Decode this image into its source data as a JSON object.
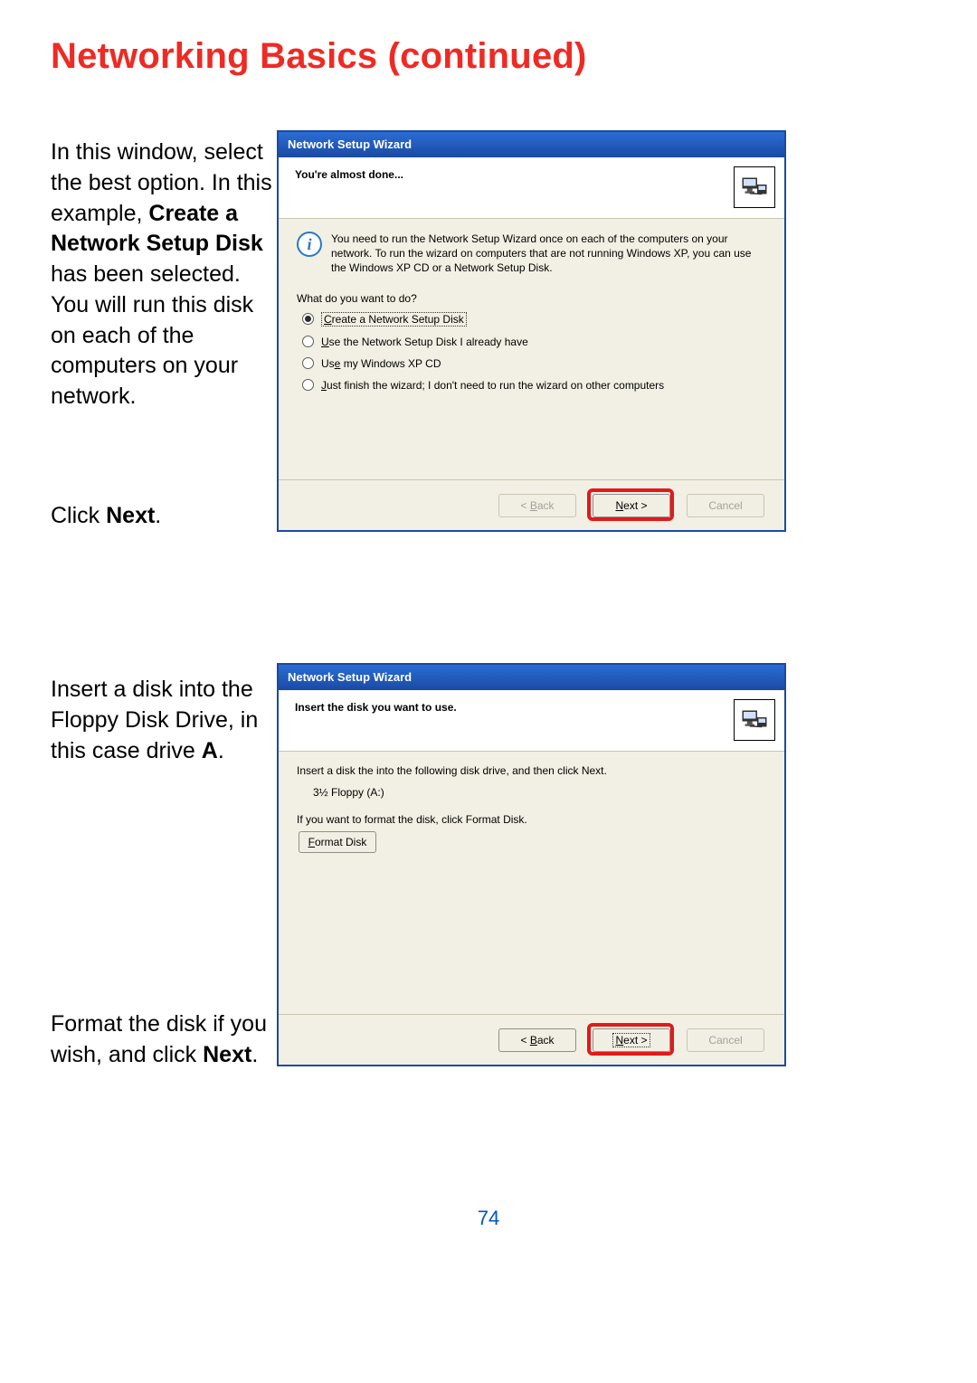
{
  "page": {
    "title": "Networking Basics (continued)",
    "number": "74"
  },
  "left": {
    "para1_pre": "In this window, select the best option. In this example, ",
    "para1_bold": "Create a Network Setup Disk",
    "para1_post": " has been selected. You will run this disk on each of the computers on your network.",
    "para2_pre": "Click ",
    "para2_bold": "Next",
    "para2_post": ".",
    "para3_pre": "Insert a disk into the Floppy Disk Drive, in this case drive ",
    "para3_bold": "A",
    "para3_post": ".",
    "para4_pre": "Format the disk if you wish, and click ",
    "para4_bold": "Next",
    "para4_post": "."
  },
  "wizard1": {
    "titlebar": "Network Setup Wizard",
    "header": "You're almost done...",
    "info": "You need to run the Network Setup Wizard once on each of the computers on your network. To run the wizard on computers that are not running Windows XP, you can use the Windows XP CD or a Network Setup Disk.",
    "prompt": "What do you want to do?",
    "options": {
      "o1_u": "C",
      "o1_rest": "reate a Network Setup Disk",
      "o2_u": "U",
      "o2_rest": "se the Network Setup Disk I already have",
      "o3_pre": "Us",
      "o3_u": "e",
      "o3_rest": " my Windows XP CD",
      "o4_u": "J",
      "o4_rest": "ust finish the wizard; I don't need to run the wizard on other computers"
    },
    "buttons": {
      "back_lt": "< ",
      "back_u": "B",
      "back_rest": "ack",
      "next_u": "N",
      "next_rest": "ext >",
      "cancel": "Cancel"
    }
  },
  "wizard2": {
    "titlebar": "Network Setup Wizard",
    "header": "Insert the disk you want to use.",
    "line1": "Insert a disk the into the following disk drive, and then click Next.",
    "drive": "3½ Floppy (A:)",
    "line2": "If you want to format the disk, click Format Disk.",
    "format_u": "F",
    "format_rest": "ormat Disk",
    "buttons": {
      "back_lt": "< ",
      "back_u": "B",
      "back_rest": "ack",
      "next_u": "N",
      "next_rest": "ext >",
      "cancel": "Cancel"
    }
  }
}
